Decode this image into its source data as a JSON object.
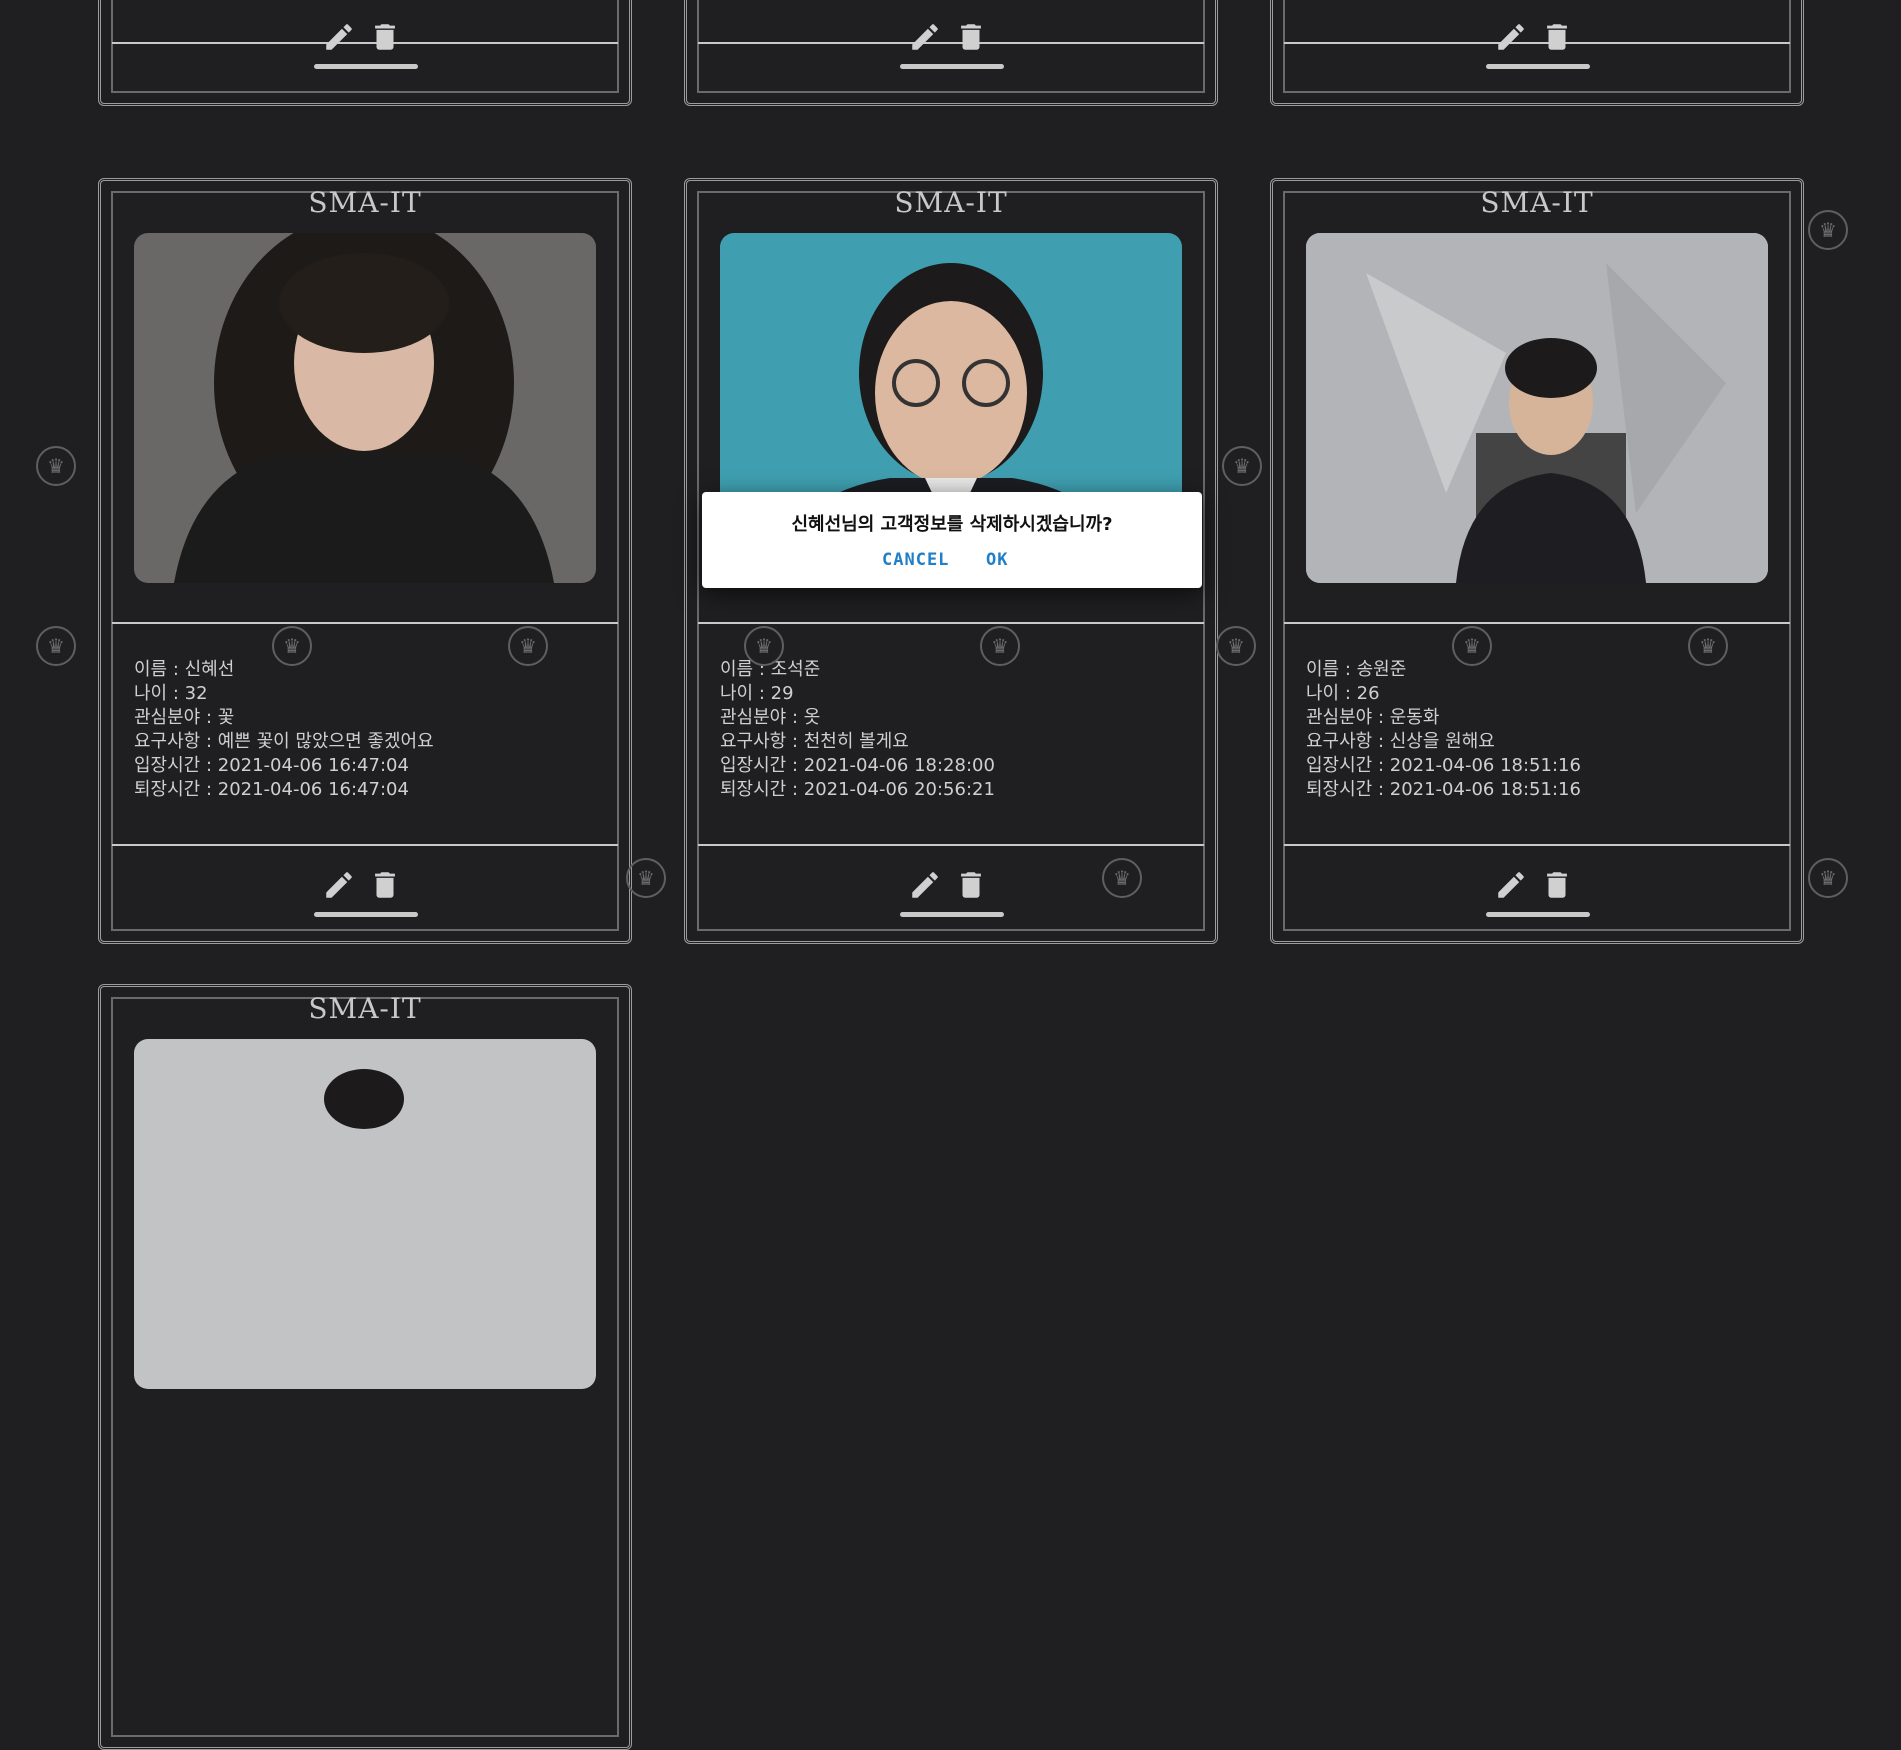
{
  "brand": "SMA-IT",
  "cards": [
    {
      "name_row": "이름 : 신혜선",
      "age_row": "나이 : 32",
      "interest_row": "관심분야 : 꽃",
      "request_row": "요구사항 : 예쁜 꽃이 많았으면 좋겠어요",
      "entry_row": "입장시간 : 2021-04-06 16:47:04",
      "exit_row": "퇴장시간 : 2021-04-06 16:47:04"
    },
    {
      "name_row": "이름 : 조석준",
      "age_row": "나이 : 29",
      "interest_row": "관심분야 : 옷",
      "request_row": "요구사항 : 천천히 볼게요",
      "entry_row": "입장시간 : 2021-04-06 18:28:00",
      "exit_row": "퇴장시간 : 2021-04-06 20:56:21"
    },
    {
      "name_row": "이름 : 송원준",
      "age_row": "나이 : 26",
      "interest_row": "관심분야 : 운동화",
      "request_row": "요구사항 : 신상을 원해요",
      "entry_row": "입장시간 : 2021-04-06 18:51:16",
      "exit_row": "퇴장시간 : 2021-04-06 18:51:16"
    }
  ],
  "dialog": {
    "message": "신혜선님의 고객정보를 삭제하시겠습니까?",
    "cancel_label": "CANCEL",
    "ok_label": "OK"
  },
  "icons": {
    "edit": "pencil-icon",
    "delete": "trash-icon",
    "watermark": "crown-icon"
  },
  "colors": {
    "background": "#1f1f22",
    "dialog_button": "#1f7fc8",
    "rose": "#b3262b"
  }
}
